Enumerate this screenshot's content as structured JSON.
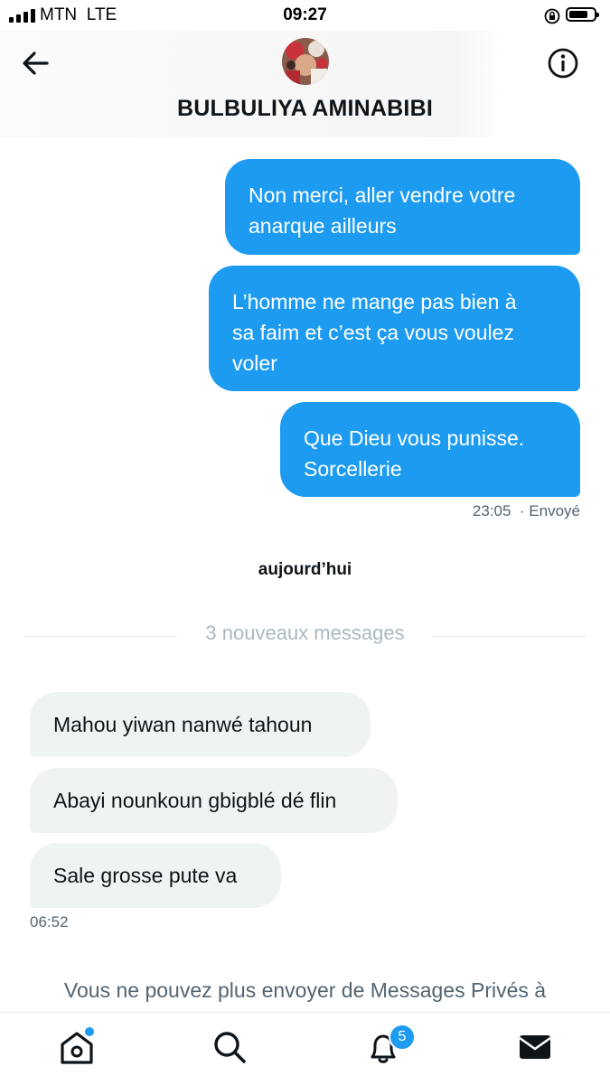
{
  "status_bar": {
    "carrier": "MTN",
    "network": "LTE",
    "time": "09:27"
  },
  "header": {
    "name": "BULBULIYA AMINABIBI",
    "back_icon": "arrow-left-icon",
    "info_icon": "info-icon"
  },
  "messages_sent": [
    {
      "lines": [
        "Non merci, aller vendre votre",
        "anarque ailleurs"
      ]
    },
    {
      "lines": [
        "L’homme ne mange pas bien à",
        "sa faim et c’est ça vous voulez",
        "voler"
      ]
    },
    {
      "lines": [
        "Que Dieu vous punisse.",
        "Sorcellerie"
      ]
    }
  ],
  "sent_meta": {
    "time": "23:05",
    "status": "· Envoyé"
  },
  "date_separator": "aujourd’hui",
  "new_messages_label": "3 nouveaux messages",
  "messages_received": [
    {
      "text": "Mahou yiwan nanwé tahoun"
    },
    {
      "text": "Abayi nounkoun gbigblé dé flin"
    },
    {
      "text": "Sale grosse pute va"
    }
  ],
  "received_meta": {
    "time": "06:52"
  },
  "blocked_notice": "Vous ne pouvez plus envoyer de Messages Privés à",
  "tab_bar": {
    "items": [
      {
        "icon": "home-icon"
      },
      {
        "icon": "search-icon"
      },
      {
        "icon": "bell-icon",
        "badge": "5"
      },
      {
        "icon": "mail-icon"
      }
    ]
  },
  "colors": {
    "accent": "#1d9bf0",
    "incoming_bubble": "#eff3f4",
    "muted_text": "#536471"
  }
}
